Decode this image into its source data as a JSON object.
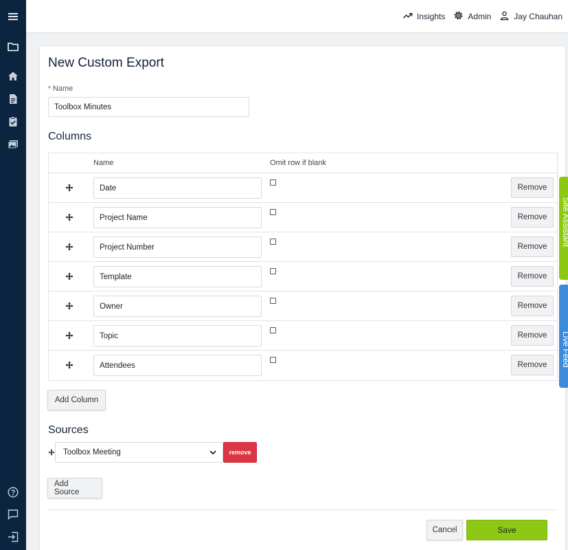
{
  "header": {
    "nav": [
      {
        "label": "Insights",
        "icon": "trend-up-icon"
      },
      {
        "label": "Admin",
        "icon": "gear-icon"
      },
      {
        "label": "Jay Chauhan",
        "icon": "user-icon"
      }
    ]
  },
  "sidebar": {
    "top": [
      "menu-icon",
      "folder-icon",
      "home-icon",
      "document-icon",
      "clipboard-check-icon",
      "images-icon"
    ],
    "bottom": [
      "help-icon",
      "chat-icon",
      "logout-icon"
    ]
  },
  "form": {
    "title": "New Custom Export",
    "name_required_mark": "*",
    "name_label": "Name",
    "name_value": "Toolbox Minutes",
    "columns_title": "Columns",
    "columns_header": {
      "name": "Name",
      "omit": "Omit row if blank"
    },
    "columns": [
      {
        "name": "Date",
        "omit": false,
        "remove": "Remove"
      },
      {
        "name": "Project Name",
        "omit": false,
        "remove": "Remove"
      },
      {
        "name": "Project Number",
        "omit": false,
        "remove": "Remove"
      },
      {
        "name": "Template",
        "omit": false,
        "remove": "Remove"
      },
      {
        "name": "Owner",
        "omit": false,
        "remove": "Remove"
      },
      {
        "name": "Topic",
        "omit": false,
        "remove": "Remove"
      },
      {
        "name": "Attendees",
        "omit": false,
        "remove": "Remove"
      }
    ],
    "add_column": "Add Column",
    "sources_title": "Sources",
    "source_selected": "Toolbox Meeting",
    "source_remove": "remove",
    "add_source": "Add Source",
    "cancel": "Cancel",
    "save": "Save"
  },
  "side_tabs": {
    "site_assistant": "Site Assistant",
    "live_feed": "Live Feed"
  },
  "colors": {
    "sidebar": "#0b2540",
    "save": "#8cc814",
    "danger": "#dc3545",
    "site_assistant_tab": "#8cc814",
    "live_feed_tab": "#3d8ad8"
  }
}
